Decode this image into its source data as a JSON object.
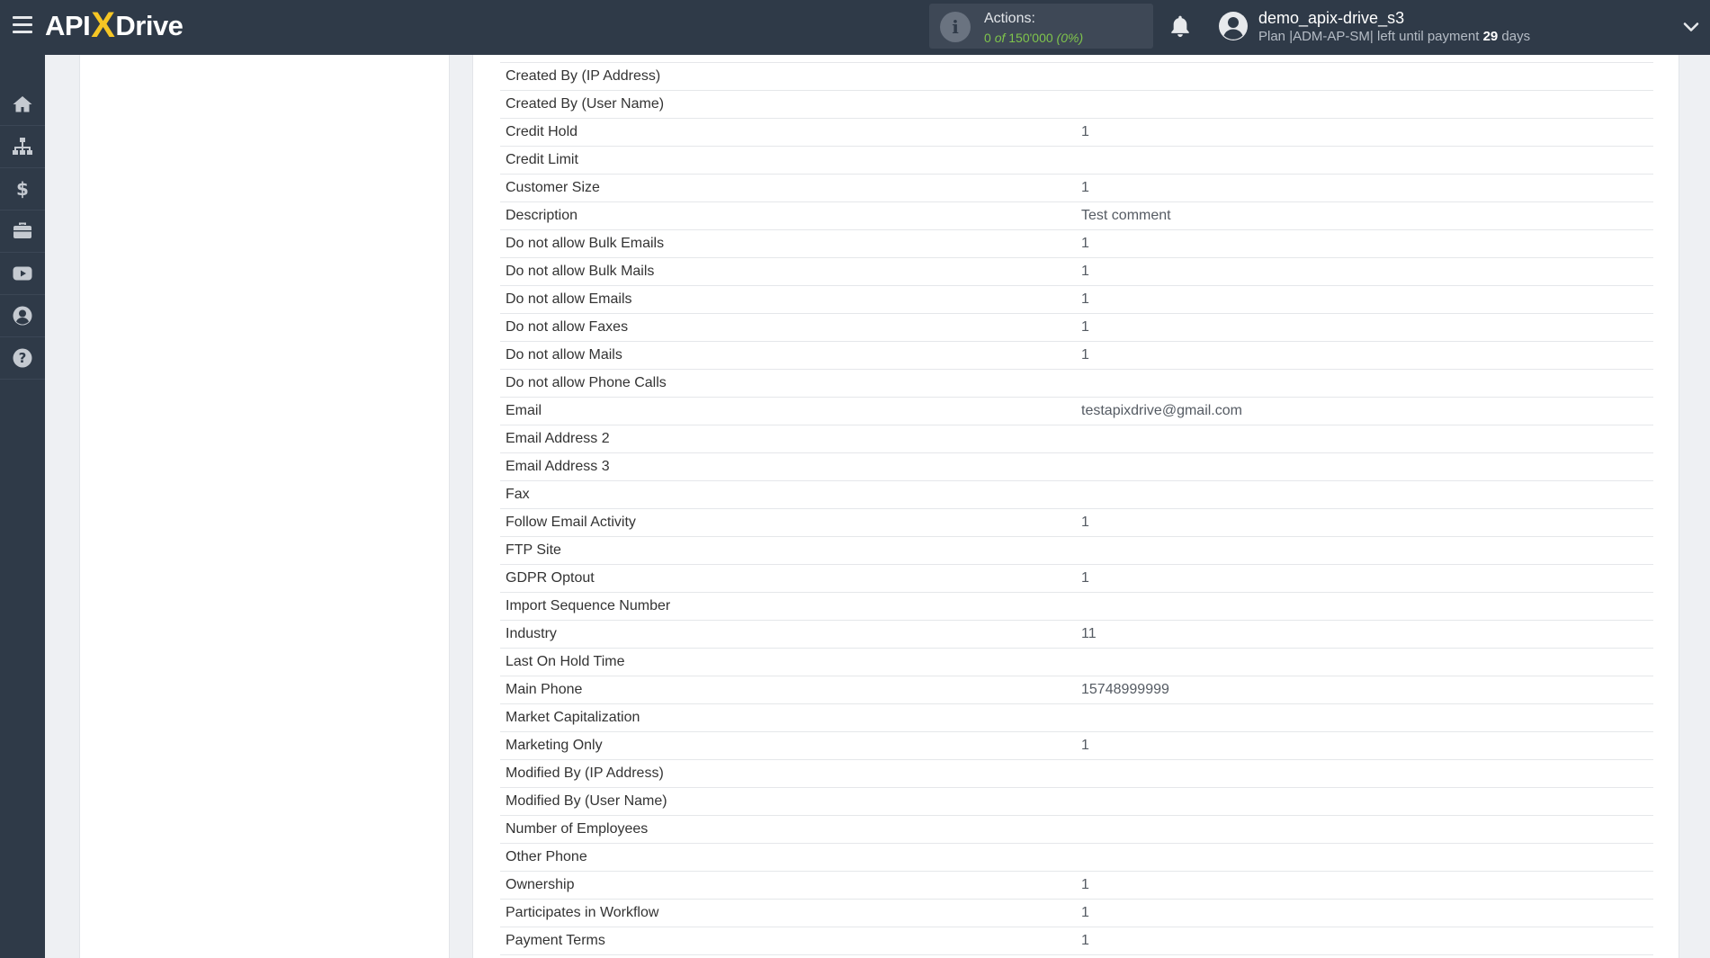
{
  "header": {
    "logo": {
      "left": "API",
      "x": "X",
      "right": "Drive"
    },
    "actions": {
      "label": "Actions:",
      "used": "0",
      "of": "of",
      "limit": "150'000",
      "percent": "(0%)"
    },
    "user": {
      "name": "demo_apix-drive_s3",
      "plan_prefix": "Plan |ADM-AP-SM| left until payment",
      "days_count": "29",
      "days_suffix": "days"
    }
  },
  "sidebar": {
    "items": [
      {
        "icon": "home-icon"
      },
      {
        "icon": "sitemap-icon"
      },
      {
        "icon": "dollar-icon"
      },
      {
        "icon": "briefcase-icon"
      },
      {
        "icon": "youtube-icon"
      },
      {
        "icon": "user-circle-icon"
      },
      {
        "icon": "help-icon"
      }
    ]
  },
  "fields": [
    {
      "label": "Created By (IP Address)",
      "value": ""
    },
    {
      "label": "Created By (User Name)",
      "value": ""
    },
    {
      "label": "Credit Hold",
      "value": "1"
    },
    {
      "label": "Credit Limit",
      "value": ""
    },
    {
      "label": "Customer Size",
      "value": "1"
    },
    {
      "label": "Description",
      "value": "Test comment"
    },
    {
      "label": "Do not allow Bulk Emails",
      "value": "1"
    },
    {
      "label": "Do not allow Bulk Mails",
      "value": "1"
    },
    {
      "label": "Do not allow Emails",
      "value": "1"
    },
    {
      "label": "Do not allow Faxes",
      "value": "1"
    },
    {
      "label": "Do not allow Mails",
      "value": "1"
    },
    {
      "label": "Do not allow Phone Calls",
      "value": ""
    },
    {
      "label": "Email",
      "value": "testapixdrive@gmail.com"
    },
    {
      "label": "Email Address 2",
      "value": ""
    },
    {
      "label": "Email Address 3",
      "value": ""
    },
    {
      "label": "Fax",
      "value": ""
    },
    {
      "label": "Follow Email Activity",
      "value": "1"
    },
    {
      "label": "FTP Site",
      "value": ""
    },
    {
      "label": "GDPR Optout",
      "value": "1"
    },
    {
      "label": "Import Sequence Number",
      "value": ""
    },
    {
      "label": "Industry",
      "value": "11"
    },
    {
      "label": "Last On Hold Time",
      "value": ""
    },
    {
      "label": "Main Phone",
      "value": "15748999999"
    },
    {
      "label": "Market Capitalization",
      "value": ""
    },
    {
      "label": "Marketing Only",
      "value": "1"
    },
    {
      "label": "Modified By (IP Address)",
      "value": ""
    },
    {
      "label": "Modified By (User Name)",
      "value": ""
    },
    {
      "label": "Number of Employees",
      "value": ""
    },
    {
      "label": "Other Phone",
      "value": ""
    },
    {
      "label": "Ownership",
      "value": "1"
    },
    {
      "label": "Participates in Workflow",
      "value": "1"
    },
    {
      "label": "Payment Terms",
      "value": "1"
    }
  ],
  "colors": {
    "header_bg": "#2f3a48",
    "logo_accent": "#f6c624",
    "actions_value": "#7fc44c"
  }
}
